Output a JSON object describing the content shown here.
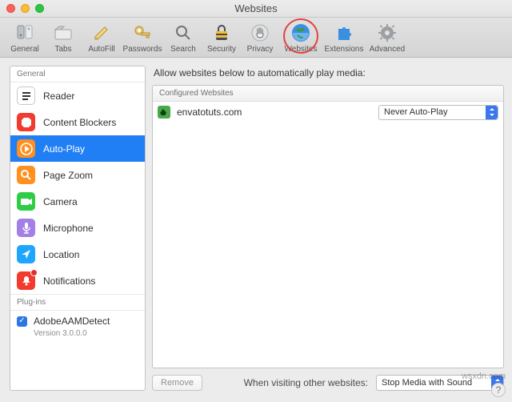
{
  "window": {
    "title": "Websites"
  },
  "toolbar": [
    {
      "key": "general",
      "label": "General",
      "selected": false,
      "highlighted": false
    },
    {
      "key": "tabs",
      "label": "Tabs",
      "selected": false,
      "highlighted": false
    },
    {
      "key": "autofill",
      "label": "AutoFill",
      "selected": false,
      "highlighted": false
    },
    {
      "key": "passwords",
      "label": "Passwords",
      "selected": false,
      "highlighted": false
    },
    {
      "key": "search",
      "label": "Search",
      "selected": false,
      "highlighted": false
    },
    {
      "key": "security",
      "label": "Security",
      "selected": false,
      "highlighted": false
    },
    {
      "key": "privacy",
      "label": "Privacy",
      "selected": false,
      "highlighted": false
    },
    {
      "key": "websites",
      "label": "Websites",
      "selected": true,
      "highlighted": true
    },
    {
      "key": "extensions",
      "label": "Extensions",
      "selected": false,
      "highlighted": false
    },
    {
      "key": "advanced",
      "label": "Advanced",
      "selected": false,
      "highlighted": false
    }
  ],
  "sidebar": {
    "section_general": "General",
    "items": [
      {
        "key": "reader",
        "label": "Reader",
        "selected": false
      },
      {
        "key": "content-blockers",
        "label": "Content Blockers",
        "selected": false
      },
      {
        "key": "auto-play",
        "label": "Auto-Play",
        "selected": true
      },
      {
        "key": "page-zoom",
        "label": "Page Zoom",
        "selected": false
      },
      {
        "key": "camera",
        "label": "Camera",
        "selected": false
      },
      {
        "key": "microphone",
        "label": "Microphone",
        "selected": false
      },
      {
        "key": "location",
        "label": "Location",
        "selected": false
      },
      {
        "key": "notifications",
        "label": "Notifications",
        "selected": false
      }
    ],
    "section_plugins": "Plug-ins",
    "plugin": {
      "checked": true,
      "name": "AdobeAAMDetect",
      "version": "Version 3.0.0.0"
    }
  },
  "main": {
    "heading": "Allow websites below to automatically play media:",
    "table_header": "Configured Websites",
    "rows": [
      {
        "site": "envatotuts.com",
        "policy": "Never Auto-Play"
      }
    ],
    "remove_label": "Remove",
    "other_label": "When visiting other websites:",
    "other_policy": "Stop Media with Sound"
  },
  "watermark": "wsxdn.com"
}
